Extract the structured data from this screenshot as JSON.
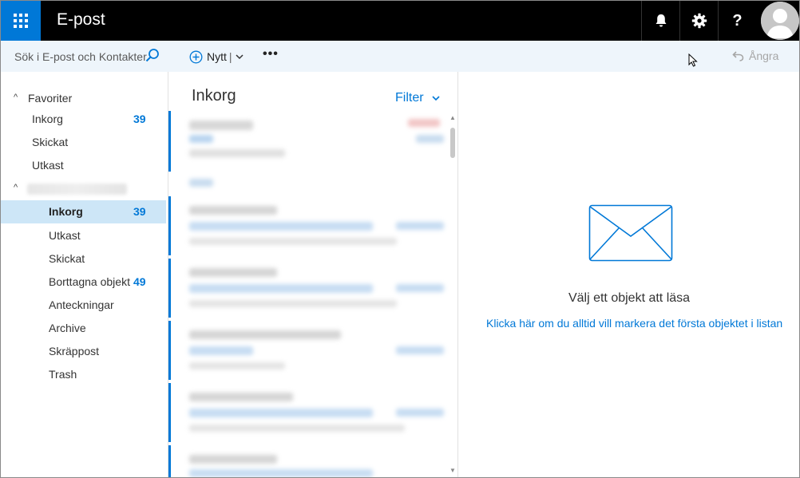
{
  "header": {
    "app_title": "E-post",
    "waffle_icon": "app-launcher-icon",
    "bell_icon": "bell-icon",
    "gear_icon": "gear-icon",
    "help_label": "?",
    "avatar_icon": "user-avatar-icon"
  },
  "search": {
    "placeholder": "Sök i E-post och Kontakter",
    "icon": "search-icon"
  },
  "toolbar": {
    "new_label": "Nytt",
    "new_separator": "|",
    "more_label": "•••",
    "undo_label": "Ångra"
  },
  "nav": {
    "favorites_label": "Favoriter",
    "favorites": [
      {
        "label": "Inkorg",
        "count": "39"
      },
      {
        "label": "Skickat",
        "count": ""
      },
      {
        "label": "Utkast",
        "count": ""
      }
    ],
    "account_folders": [
      {
        "label": "Inkorg",
        "count": "39",
        "selected": true
      },
      {
        "label": "Utkast",
        "count": ""
      },
      {
        "label": "Skickat",
        "count": ""
      },
      {
        "label": "Borttagna objekt",
        "count": "49"
      },
      {
        "label": "Anteckningar",
        "count": ""
      },
      {
        "label": "Archive",
        "count": ""
      },
      {
        "label": "Skräppost",
        "count": ""
      },
      {
        "label": "Trash",
        "count": ""
      }
    ]
  },
  "message_list": {
    "title": "Inkorg",
    "filter_label": "Filter"
  },
  "reading_pane": {
    "empty_message": "Välj ett objekt att läsa",
    "first_item_link": "Klicka här om du alltid vill markera det första objektet i listan"
  },
  "colors": {
    "accent": "#0078d7",
    "topbar": "#000000",
    "command_bar": "#eef5fb",
    "selected_folder": "#cde6f7"
  }
}
